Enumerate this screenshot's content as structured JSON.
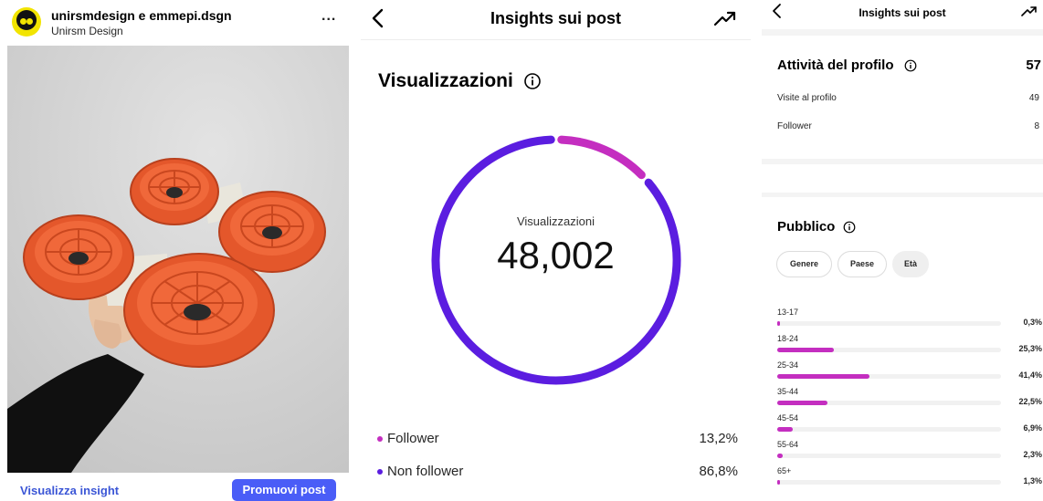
{
  "post": {
    "account_name": "unirsmdesign e emmepi.dsgn",
    "account_subtitle": "Unirsm Design",
    "more_label": "...",
    "insights_link": "Visualizza insight",
    "promote_button": "Promuovi post"
  },
  "insights": {
    "title": "Insights sui post",
    "heading": "Visualizzazioni",
    "donut_label": "Visualizzazioni",
    "total_views": "48,002",
    "legend": [
      {
        "label": "Follower",
        "value": "13,2%",
        "fraction": 0.132,
        "color": "#c42ec0"
      },
      {
        "label": "Non follower",
        "value": "86,8%",
        "fraction": 0.868,
        "color": "#5b1de0"
      }
    ]
  },
  "profile": {
    "title": "Insights sui post",
    "activity_title": "Attività del profilo",
    "activity_total": "57",
    "activity_rows": [
      {
        "label": "Visite al profilo",
        "value": "49"
      },
      {
        "label": "Follower",
        "value": "8"
      }
    ],
    "audience_title": "Pubblico",
    "tabs": [
      "Genere",
      "Paese",
      "Età"
    ],
    "selected_tab": "Età",
    "age_groups": [
      {
        "label": "13-17",
        "value": "0,3%",
        "fraction": 0.003
      },
      {
        "label": "18-24",
        "value": "25,3%",
        "fraction": 0.253
      },
      {
        "label": "25-34",
        "value": "41,4%",
        "fraction": 0.414
      },
      {
        "label": "35-44",
        "value": "22,5%",
        "fraction": 0.225
      },
      {
        "label": "45-54",
        "value": "6,9%",
        "fraction": 0.069
      },
      {
        "label": "55-64",
        "value": "2,3%",
        "fraction": 0.023
      },
      {
        "label": "65+",
        "value": "1,3%",
        "fraction": 0.013
      }
    ]
  },
  "colors": {
    "follower": "#c42ec0",
    "non_follower": "#5b1de0",
    "link": "#3b56d6",
    "button": "#4a5df7",
    "bar": "#c42ec0"
  },
  "icons": [
    "avatar-logo",
    "more-icon",
    "back-icon",
    "trend-icon",
    "info-icon"
  ]
}
